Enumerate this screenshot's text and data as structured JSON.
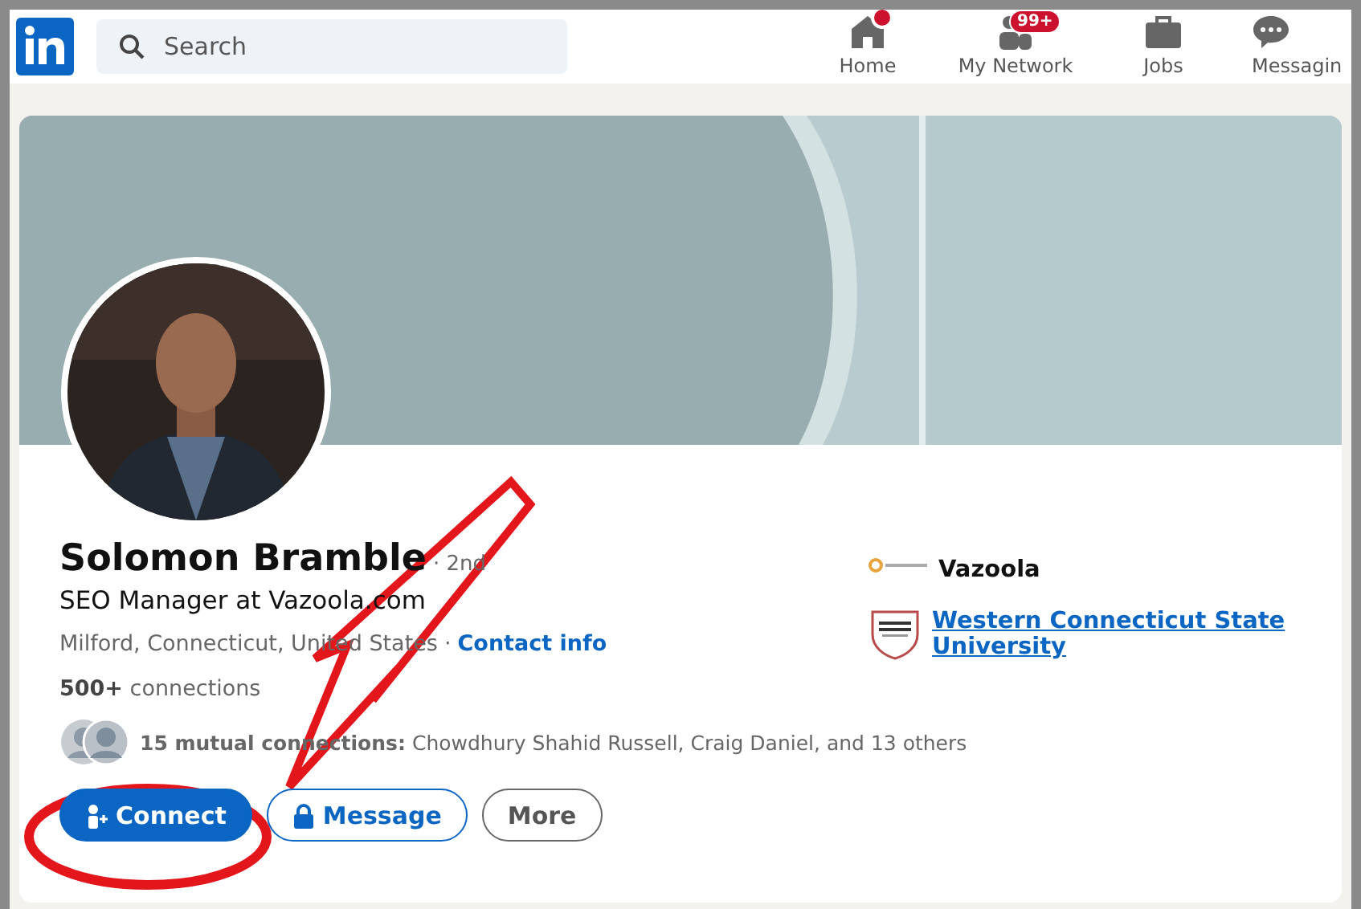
{
  "nav": {
    "search": {
      "placeholder": "Search"
    },
    "items": [
      {
        "label": "Home",
        "selected": false
      },
      {
        "label": "My Network",
        "badge": "99+",
        "selected": false
      },
      {
        "label": "Jobs",
        "selected": false
      },
      {
        "label": "Messagin",
        "selected": false
      }
    ]
  },
  "profile": {
    "name": "Solomon Bramble",
    "degree": "· 2nd",
    "headline": "SEO Manager at Vazoola.com",
    "location": "Milford, Connecticut, United States",
    "separator": "·",
    "contact_link": "Contact info",
    "connections_count": "500+",
    "connections_label": "connections",
    "mutual": "**15 mutual connections:** Chowdhury Shahid Russell, Craig Daniel, and 13 others",
    "buttons": [
      {
        "label": "Connect",
        "kind": "primary"
      },
      {
        "label": "Message",
        "kind": "secondary"
      },
      {
        "label": "More",
        "kind": "neutral"
      }
    ],
    "experience": [
      {
        "name": "Vazoola",
        "kind": "company"
      },
      {
        "name": "Western Connecticut State University",
        "kind": "school"
      }
    ]
  }
}
